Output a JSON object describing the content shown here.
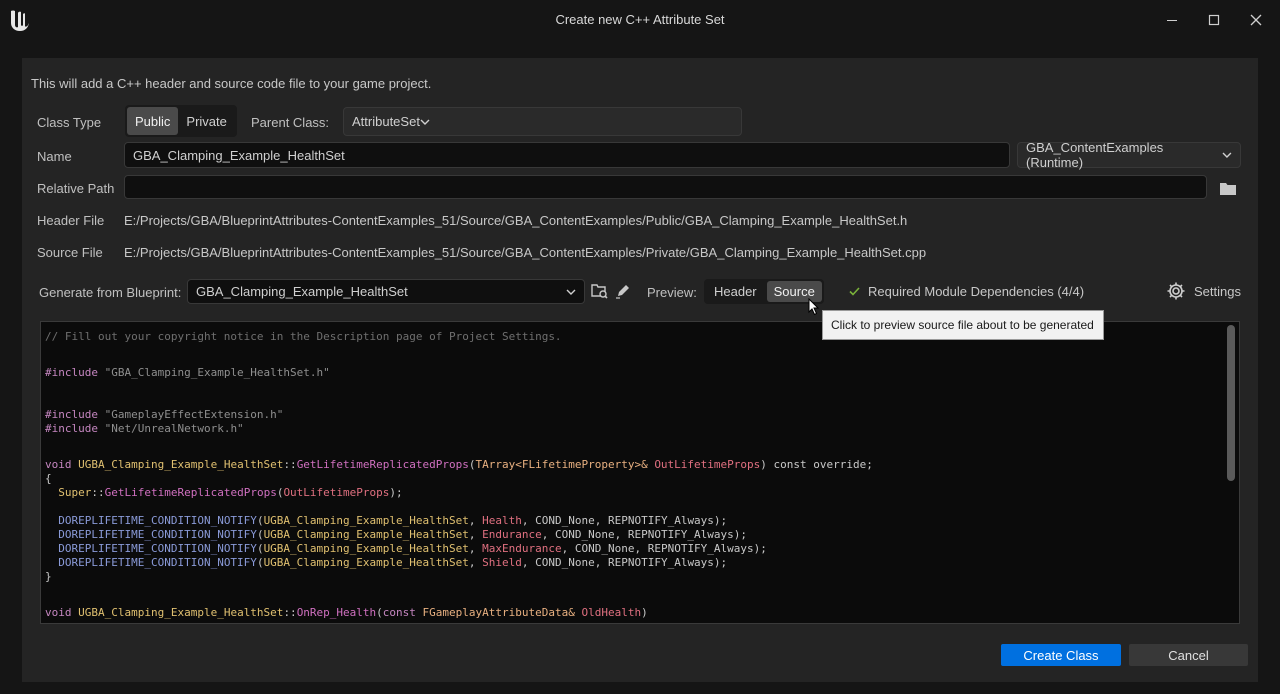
{
  "window": {
    "title": "Create new C++ Attribute Set"
  },
  "info_text": "This will add a C++ header and source code file to your game project.",
  "class_type": {
    "label": "Class Type",
    "options": [
      "Public",
      "Private"
    ],
    "selected": "Public"
  },
  "parent_class": {
    "label": "Parent Class:",
    "value": "AttributeSet"
  },
  "name": {
    "label": "Name",
    "value": "GBA_Clamping_Example_HealthSet",
    "module": "GBA_ContentExamples (Runtime)"
  },
  "relative_path": {
    "label": "Relative Path",
    "value": ""
  },
  "header_file": {
    "label": "Header File",
    "value": "E:/Projects/GBA/BlueprintAttributes-ContentExamples_51/Source/GBA_ContentExamples/Public/GBA_Clamping_Example_HealthSet.h"
  },
  "source_file": {
    "label": "Source File",
    "value": "E:/Projects/GBA/BlueprintAttributes-ContentExamples_51/Source/GBA_ContentExamples/Private/GBA_Clamping_Example_HealthSet.cpp"
  },
  "generate": {
    "label": "Generate from Blueprint:",
    "value": "GBA_Clamping_Example_HealthSet"
  },
  "preview": {
    "label": "Preview:",
    "options": [
      "Header",
      "Source"
    ],
    "selected": "Source"
  },
  "dependencies": {
    "text": "Required Module Dependencies (4/4)"
  },
  "settings": {
    "label": "Settings"
  },
  "tooltip": {
    "text": "Click to preview source file about to be generated"
  },
  "code": {
    "comment": "// Fill out your copyright notice in the Description page of Project Settings.",
    "include_kw": "#include",
    "include1": "\"GBA_Clamping_Example_HealthSet.h\"",
    "include2": "\"GameplayEffectExtension.h\"",
    "include3": "\"Net/UnrealNetwork.h\"",
    "void_kw": "void",
    "class_name": "UGBA_Clamping_Example_HealthSet",
    "scope": "::",
    "fn1": "GetLifetimeReplicatedProps",
    "fn1_paren": "(",
    "tarray": "TArray<FLifetimeProperty>&",
    "param1": "OutLifetimeProps",
    "fn1_tail": ") const override;",
    "open_brace": "{",
    "super": "Super",
    "super_call_param": "OutLifetimeProps",
    "super_tail": ");",
    "macro": "DOREPLIFETIME_CONDITION_NOTIFY",
    "comma": ",",
    "attr1": "Health",
    "attr2": "Endurance",
    "attr3": "MaxEndurance",
    "attr4": "Shield",
    "cond_tail": ", COND_None, REPNOTIFY_Always);",
    "close_brace": "}",
    "fn2": "OnRep_Health",
    "const_kw": "const",
    "fn2_type": "FGameplayAttributeData&",
    "fn2_param": "OldHealth",
    "fn2_tail": ")"
  },
  "buttons": {
    "create": "Create Class",
    "cancel": "Cancel"
  },
  "colors": {
    "accent": "#0070e0",
    "background": "#151515",
    "panel": "#242424"
  }
}
